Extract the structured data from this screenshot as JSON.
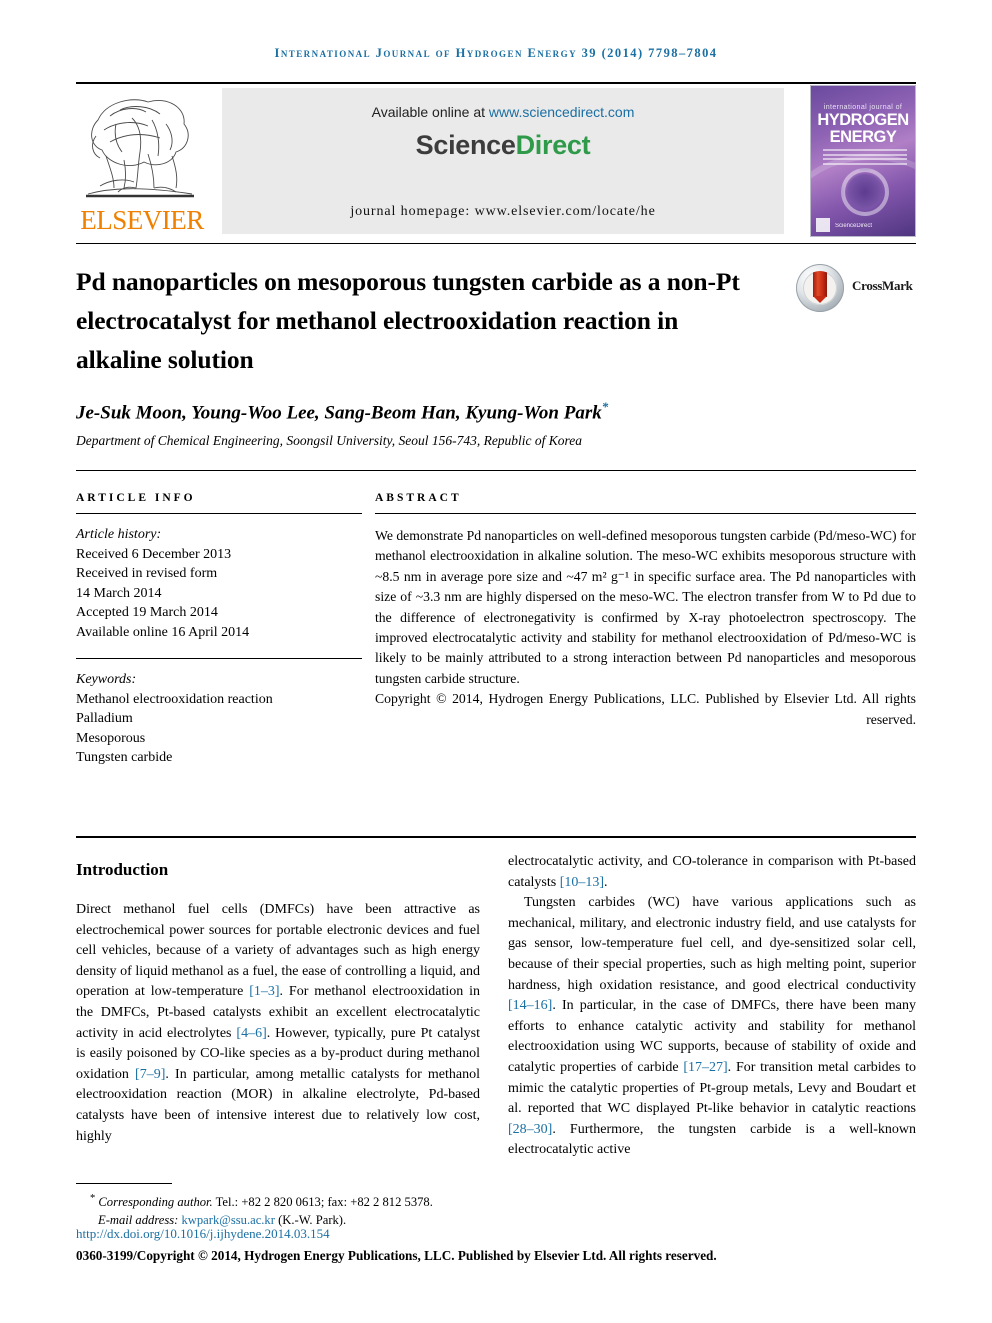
{
  "running_head": "International Journal of Hydrogen Energy 39 (2014) 7798–7804",
  "masthead": {
    "publisher_name": "ELSEVIER",
    "available_prefix": "Available online at ",
    "available_url": "www.sciencedirect.com",
    "brand_sci": "Science",
    "brand_direct": "Direct",
    "homepage": "journal homepage: www.elsevier.com/locate/he",
    "cover": {
      "line_top": "international journal of",
      "word1": "HYDROGEN",
      "word2": "ENERGY",
      "footer_brand": "ScienceDirect"
    }
  },
  "article": {
    "title": "Pd nanoparticles on mesoporous tungsten carbide as a non-Pt electrocatalyst for methanol electrooxidation reaction in alkaline solution",
    "crossmark_label": "CrossMark",
    "authors": "Je-Suk Moon, Young-Woo Lee, Sang-Beom Han, Kyung-Won Park",
    "author_marker": "*",
    "affiliation": "Department of Chemical Engineering, Soongsil University, Seoul 156-743, Republic of Korea"
  },
  "article_info": {
    "heading": "ARTICLE INFO",
    "history_label": "Article history:",
    "history": [
      "Received 6 December 2013",
      "Received in revised form",
      "14 March 2014",
      "Accepted 19 March 2014",
      "Available online 16 April 2014"
    ],
    "keywords_label": "Keywords:",
    "keywords": [
      "Methanol electrooxidation reaction",
      "Palladium",
      "Mesoporous",
      "Tungsten carbide"
    ]
  },
  "abstract": {
    "heading": "ABSTRACT",
    "body": "We demonstrate Pd nanoparticles on well-defined mesoporous tungsten carbide (Pd/meso-WC) for methanol electrooxidation in alkaline solution. The meso-WC exhibits mesoporous structure with ~8.5 nm in average pore size and ~47 m² g⁻¹ in specific surface area. The Pd nanoparticles with size of ~3.3 nm are highly dispersed on the meso-WC. The electron transfer from W to Pd due to the difference of electronegativity is confirmed by X-ray photoelectron spectroscopy. The improved electrocatalytic activity and stability for methanol electrooxidation of Pd/meso-WC is likely to be mainly attributed to a strong interaction between Pd nanoparticles and mesoporous tungsten carbide structure.",
    "copyright": "Copyright © 2014, Hydrogen Energy Publications, LLC. Published by Elsevier Ltd. All rights reserved."
  },
  "body": {
    "section_heading": "Introduction",
    "left_paragraph": "Direct methanol fuel cells (DMFCs) have been attractive as electrochemical power sources for portable electronic devices and fuel cell vehicles, because of a variety of advantages such as high energy density of liquid methanol as a fuel, the ease of controlling a liquid, and operation at low-temperature [1–3]. For methanol electrooxidation in the DMFCs, Pt-based catalysts exhibit an excellent electrocatalytic activity in acid electrolytes [4–6]. However, typically, pure Pt catalyst is easily poisoned by CO-like species as a by-product during methanol oxidation [7–9]. In particular, among metallic catalysts for methanol electrooxidation reaction (MOR) in alkaline electrolyte, Pd-based catalysts have been of intensive interest due to relatively low cost, highly",
    "right_paragraph_1": "electrocatalytic activity, and CO-tolerance in comparison with Pt-based catalysts [10–13].",
    "right_paragraph_2": "Tungsten carbides (WC) have various applications such as mechanical, military, and electronic industry field, and use catalysts for gas sensor, low-temperature fuel cell, and dye-sensitized solar cell, because of their special properties, such as high melting point, superior hardness, high oxidation resistance, and good electrical conductivity [14–16]. In particular, in the case of DMFCs, there have been many efforts to enhance catalytic activity and stability for methanol electrooxidation using WC supports, because of stability of oxide and catalytic properties of carbide [17–27]. For transition metal carbides to mimic the catalytic properties of Pt-group metals, Levy and Boudart et al. reported that WC displayed Pt-like behavior in catalytic reactions [28–30]. Furthermore, the tungsten carbide is a well-known electrocatalytic active",
    "references_inline": [
      "[1–3]",
      "[4–6]",
      "[7–9]",
      "[10–13]",
      "[14–16]",
      "[17–27]",
      "[28–30]"
    ]
  },
  "footnote": {
    "corresponding_marker": "*",
    "corresponding_label": "Corresponding author.",
    "contact": " Tel.: +82 2 820 0613; fax: +82 2 812 5378.",
    "email_label": "E-mail address: ",
    "email": "kwpark@ssu.ac.kr",
    "email_suffix": " (K.-W. Park).",
    "doi": "http://dx.doi.org/10.1016/j.ijhydene.2014.03.154",
    "issn_line": "0360-3199/Copyright © 2014, Hydrogen Energy Publications, LLC. Published by Elsevier Ltd. All rights reserved."
  },
  "colors": {
    "link": "#1A6FA3",
    "elsevier_orange": "#F08000",
    "sciencedirect_green": "#2E9A4A"
  }
}
